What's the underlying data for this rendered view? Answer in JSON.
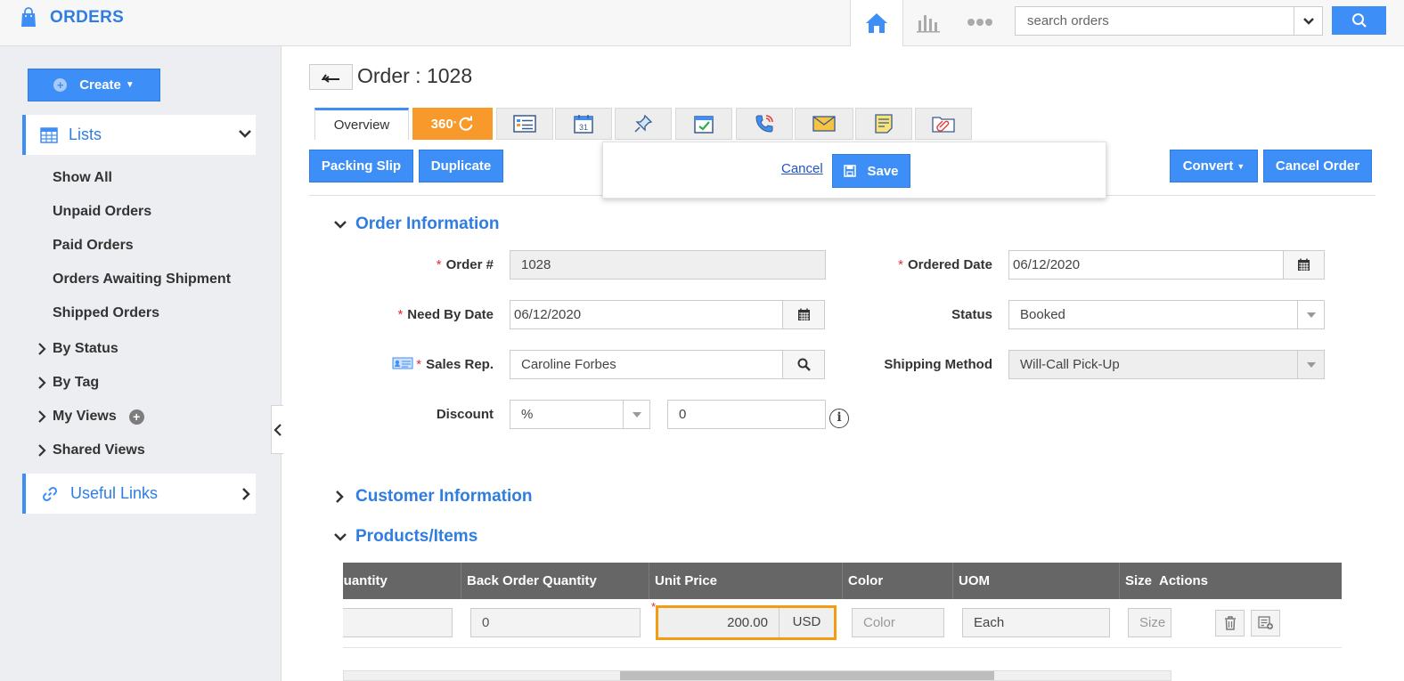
{
  "app": {
    "title": "ORDERS"
  },
  "topbar": {
    "search_placeholder": "search orders"
  },
  "sidebar": {
    "create_label": "Create",
    "lists_label": "Lists",
    "list_items": [
      "Show All",
      "Unpaid Orders",
      "Paid Orders",
      "Orders Awaiting Shipment",
      "Shipped Orders"
    ],
    "groups": [
      "By Status",
      "By Tag",
      "My Views",
      "Shared Views"
    ],
    "useful_links_label": "Useful Links"
  },
  "page": {
    "title": "Order : 1028"
  },
  "tabs": {
    "overview": "Overview",
    "t360": "360"
  },
  "actions": {
    "packing_slip": "Packing Slip",
    "duplicate": "Duplicate",
    "cancel_link": "Cancel",
    "save": "Save",
    "convert": "Convert",
    "cancel_order": "Cancel Order"
  },
  "order_info": {
    "title": "Order Information",
    "order_no_label": "Order #",
    "order_no": "1028",
    "ordered_date_label": "Ordered Date",
    "ordered_date": "06/12/2020",
    "need_by_label": "Need By Date",
    "need_by": "06/12/2020",
    "status_label": "Status",
    "status": "Booked",
    "sales_rep_label": "Sales Rep.",
    "sales_rep": "Caroline Forbes",
    "shipping_label": "Shipping Method",
    "shipping": "Will-Call Pick-Up",
    "discount_label": "Discount",
    "discount_type": "%",
    "discount_value": "0"
  },
  "customer_info": {
    "title": "Customer Information"
  },
  "products": {
    "title": "Products/Items",
    "columns": [
      "Quantity",
      "Back Order Quantity",
      "Unit Price",
      "Color",
      "UOM",
      "Size",
      "Actions"
    ],
    "row": {
      "quantity": "",
      "back_order": "0",
      "unit_price": "200.00",
      "currency": "USD",
      "color_placeholder": "Color",
      "uom": "Each",
      "size_placeholder": "Size"
    }
  },
  "colors": {
    "accent": "#3e8ef7",
    "orange": "#f79a2b",
    "required": "#e52b2b"
  }
}
